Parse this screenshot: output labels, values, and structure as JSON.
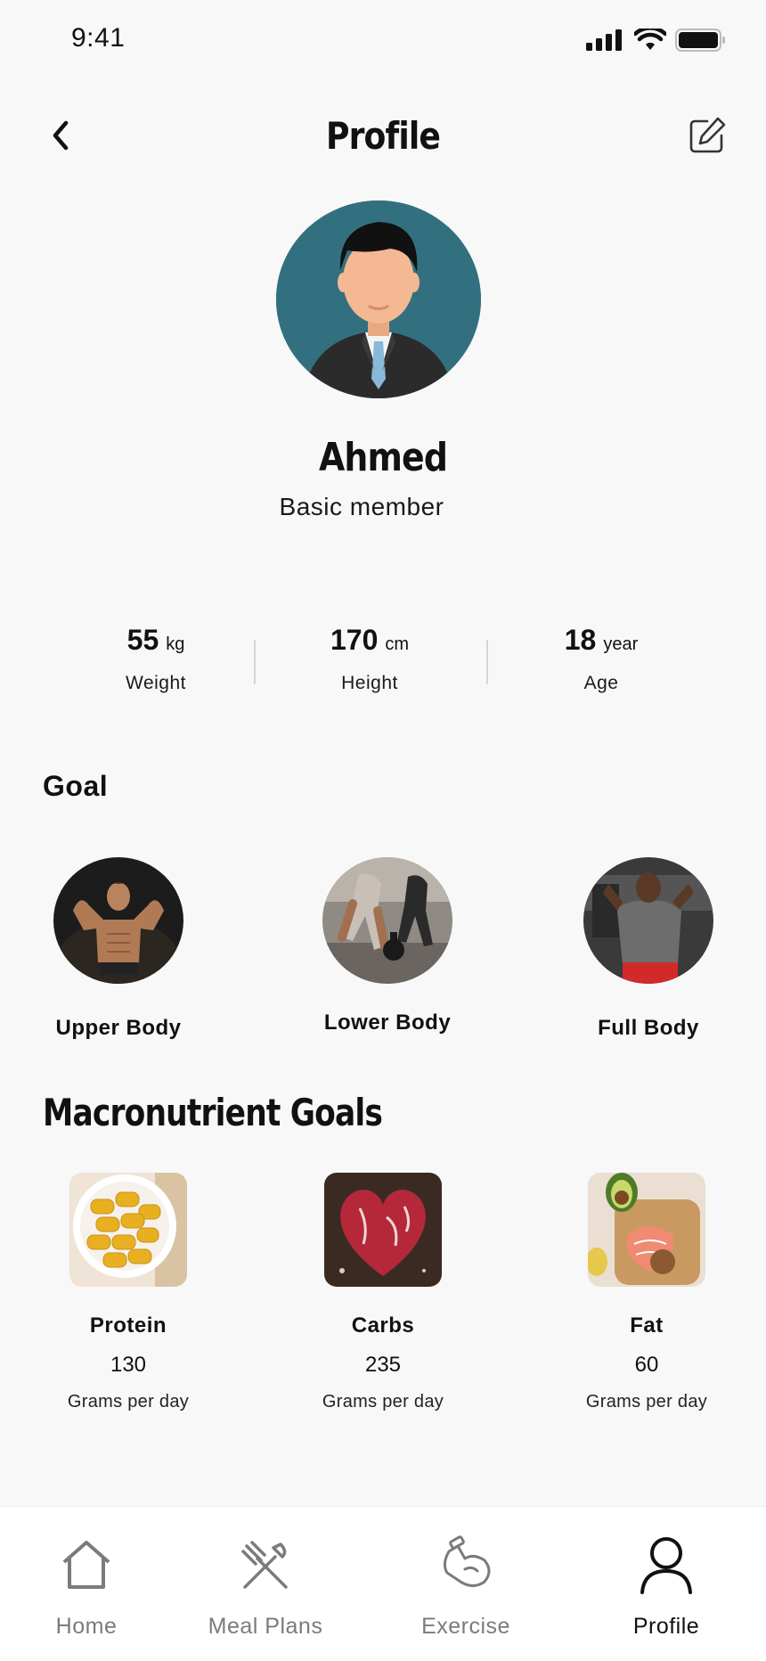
{
  "status_bar": {
    "time": "9:41"
  },
  "header": {
    "title": "Profile",
    "back_icon": "chevron-left-icon",
    "edit_icon": "edit-icon"
  },
  "user": {
    "name": "Ahmed",
    "membership": "Basic member"
  },
  "stats": [
    {
      "value": "55",
      "unit": "kg",
      "label": "Weight"
    },
    {
      "value": "170",
      "unit": "cm",
      "label": "Height"
    },
    {
      "value": "18",
      "unit": "year",
      "label": "Age"
    }
  ],
  "goal": {
    "title": "Goal",
    "items": [
      {
        "label": "Upper Body"
      },
      {
        "label": "Lower Body"
      },
      {
        "label": "Full Body"
      }
    ]
  },
  "macros": {
    "title": "Macronutrient Goals",
    "items": [
      {
        "name": "Protein",
        "value": "130",
        "unit": "Grams per day"
      },
      {
        "name": "Carbs",
        "value": "235",
        "unit": "Grams per day"
      },
      {
        "name": "Fat",
        "value": "60",
        "unit": "Grams per day"
      }
    ]
  },
  "tabs": [
    {
      "label": "Home",
      "icon": "home-icon",
      "active": false
    },
    {
      "label": "Meal Plans",
      "icon": "utensils-icon",
      "active": false
    },
    {
      "label": "Exercise",
      "icon": "flexed-arm-icon",
      "active": false
    },
    {
      "label": "Profile",
      "icon": "user-icon",
      "active": true
    }
  ],
  "colors": {
    "avatar_bg": "#33707f",
    "active_tab": "#111111",
    "inactive_tab": "#7b7b7b"
  }
}
